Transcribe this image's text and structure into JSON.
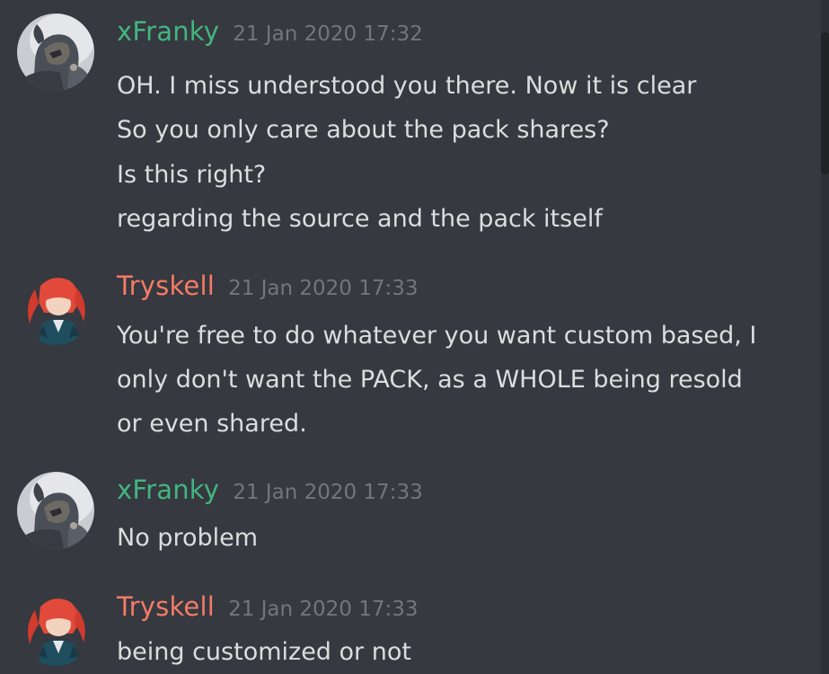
{
  "colors": {
    "background": "#36393f",
    "message_text": "#dcddde",
    "timestamp": "#72767d",
    "xfranky": "#43b581",
    "tryskell": "#f47b67"
  },
  "messages": [
    {
      "author": "xFranky",
      "timestamp": "21 Jan 2020 17:32",
      "avatar": "xfranky-avatar",
      "lines": [
        "OH. I miss understood you there. Now it is clear",
        "So you only care about the pack shares?",
        "Is this right?",
        "regarding the source and the pack itself"
      ]
    },
    {
      "author": "Tryskell",
      "timestamp": "21 Jan 2020 17:33",
      "avatar": "tryskell-avatar",
      "lines": [
        "You're free to do whatever you want custom based, I",
        "only don't want the PACK, as a WHOLE being resold",
        "or even shared."
      ]
    },
    {
      "author": "xFranky",
      "timestamp": "21 Jan 2020 17:33",
      "avatar": "xfranky-avatar",
      "lines": [
        "No problem"
      ]
    },
    {
      "author": "Tryskell",
      "timestamp": "21 Jan 2020 17:33",
      "avatar": "tryskell-avatar",
      "lines": [
        "being customized or not"
      ]
    }
  ]
}
